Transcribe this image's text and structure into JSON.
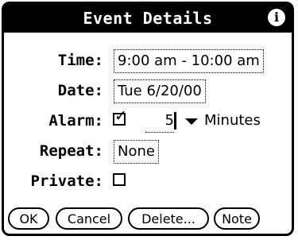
{
  "header": {
    "title": "Event Details",
    "info_icon": "i"
  },
  "fields": {
    "time": {
      "label": "Time:",
      "value": "9:00 am - 10:00 am"
    },
    "date": {
      "label": "Date:",
      "value": "Tue 6/20/00"
    },
    "alarm": {
      "label": "Alarm:",
      "checked": true,
      "value": "5",
      "unit": "Minutes"
    },
    "repeat": {
      "label": "Repeat:",
      "value": "None"
    },
    "private": {
      "label": "Private:",
      "checked": false
    }
  },
  "buttons": {
    "ok": "OK",
    "cancel": "Cancel",
    "delete": "Delete...",
    "note": "Note"
  }
}
